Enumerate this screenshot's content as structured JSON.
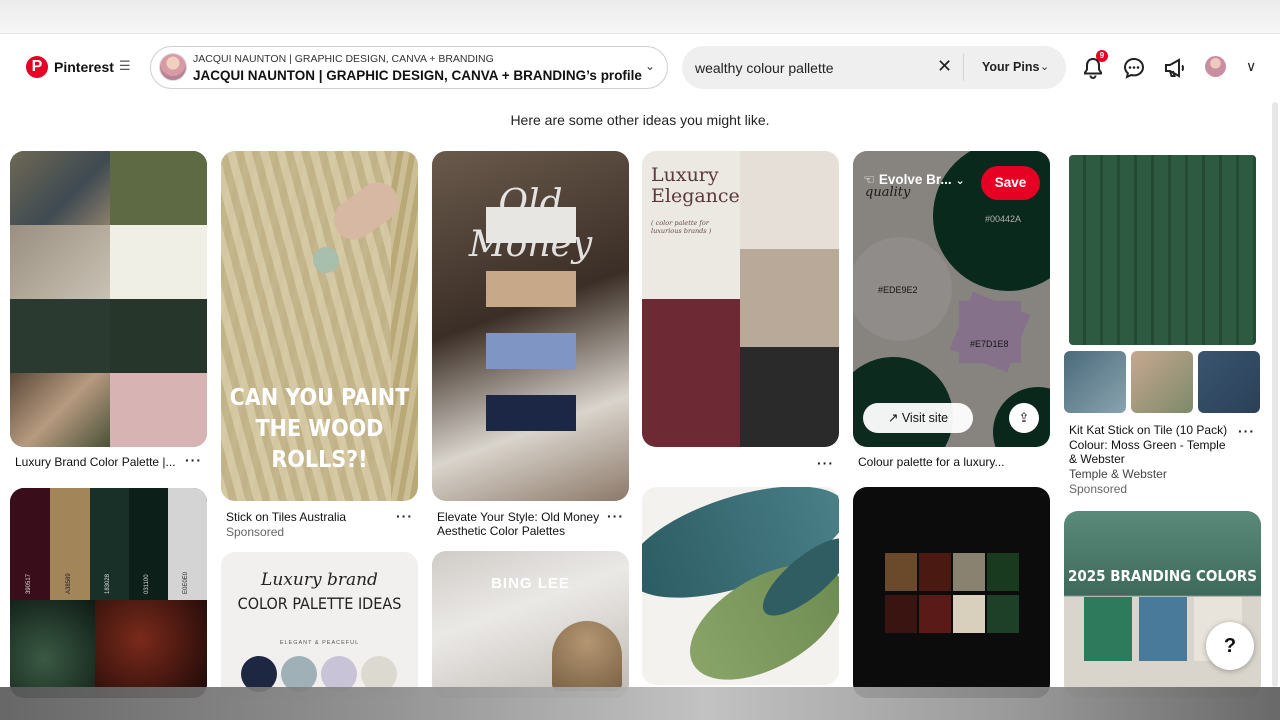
{
  "header": {
    "brand": "Pinterest",
    "profile_small": "JACQUI NAUNTON | GRAPHIC DESIGN, CANVA + BRANDING",
    "profile_big": "JACQUI NAUNTON | GRAPHIC DESIGN, CANVA + BRANDING’s profile",
    "search_value": "wealthy colour pallette",
    "your_pins": "Your Pins",
    "bell_badge": "9"
  },
  "ideas_text": "Here are some other ideas you might like.",
  "pins": {
    "p1": {
      "title": "Luxury Brand Color Palette |..."
    },
    "p2": {
      "title": "Stick on Tiles Australia",
      "sub": "Sponsored",
      "overlay_line1": "CAN YOU PAINT",
      "overlay_line2": "THE WOOD ROLLS?!"
    },
    "p3": {
      "title_line1": "Elevate Your Style: Old Money",
      "title_line2": "Aesthetic Color Palettes",
      "overlay": "Old Money"
    },
    "p4": {
      "heading_line1": "Luxury",
      "heading_line2": "Elegance",
      "heading_sub": "( color palette for luxurious brands )"
    },
    "p5": {
      "title": "Colour palette for a luxury...",
      "board": "Evolve Br...",
      "save": "Save",
      "visit": "Visit site",
      "hex1": "#00442A",
      "hex2": "#EDE9E2",
      "hex3": "#E7D1E8",
      "tag": "quality"
    },
    "p6": {
      "title_line1": "Kit Kat Stick on Tile (10 Pack)",
      "title_line2": "Colour: Moss Green - Temple",
      "title_line3": "& Webster",
      "source": "Temple & Webster",
      "sub": "Sponsored"
    },
    "p7": {
      "codes": [
        "390517",
        "A38589",
        "183028",
        "031100",
        "E0E0E0"
      ]
    },
    "p8": {
      "line1": "Luxury brand",
      "line2": "COLOR PALETTE IDEAS",
      "line3": "ELEGANT & PEACEFUL"
    },
    "p9": {
      "overlay": "BING LEE"
    },
    "p12": {
      "overlay": "2025 BRANDING COLORS"
    }
  },
  "help_label": "?"
}
